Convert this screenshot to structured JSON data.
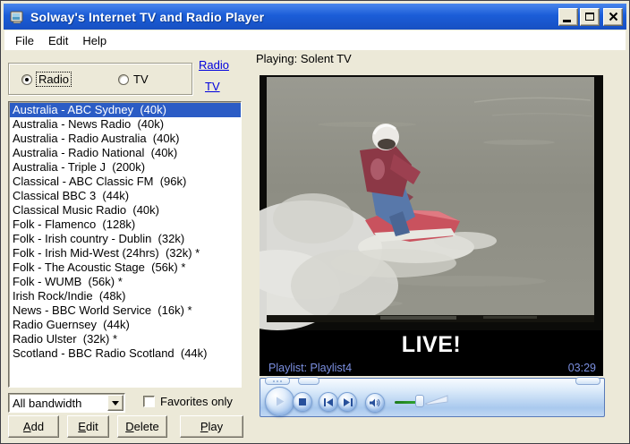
{
  "window": {
    "title": "Solway's Internet TV and Radio Player"
  },
  "menu": {
    "items": [
      "File",
      "Edit",
      "Help"
    ]
  },
  "band_selector": {
    "options": [
      {
        "label": "Radio",
        "selected": true
      },
      {
        "label": "TV",
        "selected": false
      }
    ]
  },
  "quick_links": [
    {
      "label": "Radio"
    },
    {
      "label": "TV"
    }
  ],
  "stations": {
    "items": [
      {
        "label": "Australia - ABC Sydney  (40k)",
        "selected": true
      },
      {
        "label": "Australia - News Radio  (40k)",
        "selected": false
      },
      {
        "label": "Australia - Radio Australia  (40k)",
        "selected": false
      },
      {
        "label": "Australia - Radio National  (40k)",
        "selected": false
      },
      {
        "label": "Australia - Triple J  (200k)",
        "selected": false
      },
      {
        "label": "Classical - ABC Classic FM  (96k)",
        "selected": false
      },
      {
        "label": "Classical BBC 3  (44k)",
        "selected": false
      },
      {
        "label": "Classical Music Radio  (40k)",
        "selected": false
      },
      {
        "label": "Folk - Flamenco  (128k)",
        "selected": false
      },
      {
        "label": "Folk - Irish country - Dublin  (32k)",
        "selected": false
      },
      {
        "label": "Folk - Irish Mid-West (24hrs)  (32k) *",
        "selected": false
      },
      {
        "label": "Folk - The Acoustic Stage  (56k) *",
        "selected": false
      },
      {
        "label": "Folk - WUMB  (56k) *",
        "selected": false
      },
      {
        "label": "Irish Rock/Indie  (48k)",
        "selected": false
      },
      {
        "label": "News - BBC World Service  (16k) *",
        "selected": false
      },
      {
        "label": "Radio Guernsey  (44k)",
        "selected": false
      },
      {
        "label": "Radio Ulster  (32k) *",
        "selected": false
      },
      {
        "label": "Scotland - BBC Radio Scotland  (44k)",
        "selected": false
      }
    ]
  },
  "filter": {
    "bandwidth_value": "All bandwidth",
    "favorites_label": "Favorites only",
    "favorites_checked": false
  },
  "actions": {
    "add": "Add",
    "edit": "Edit",
    "delete": "Delete",
    "play": "Play"
  },
  "player": {
    "now_playing": "Playing: Solent TV",
    "live_overlay": "LIVE!",
    "playlist": "Playlist: Playlist4",
    "elapsed": "03:29"
  },
  "colors": {
    "titlebar": "#1b5dd8",
    "selection": "#2b5cc5",
    "link": "#0000dd",
    "window_bg": "#ece9d8",
    "playlist_text": "#7b8fe0",
    "volume_green": "#2fa32f",
    "wmp_border": "#587ab8"
  }
}
